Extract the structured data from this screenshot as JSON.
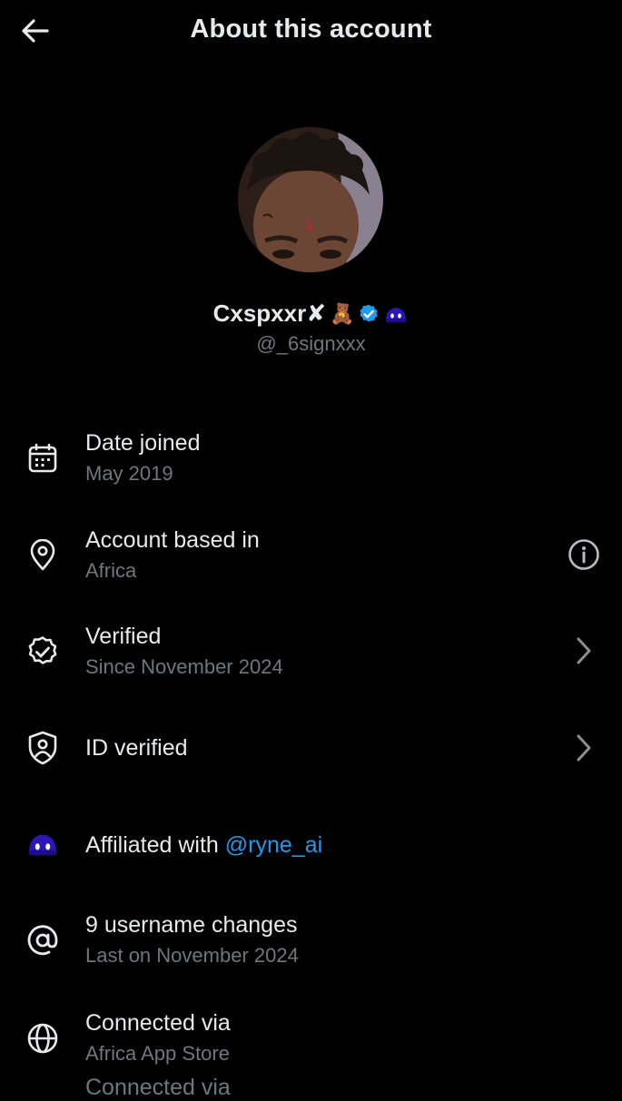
{
  "header": {
    "title": "About this account",
    "back_icon": "arrow-left-icon"
  },
  "profile": {
    "display_name": "Cxspxxr✘",
    "emoji_badge": "🧸",
    "verified_badge_icon": "verified-checkmark-icon",
    "affiliate_badge_icon": "ryne-ai-affiliate-icon",
    "handle": "@_6signxxx"
  },
  "rows": {
    "date_joined": {
      "icon": "calendar-icon",
      "title": "Date joined",
      "subtitle": "May 2019"
    },
    "based_in": {
      "icon": "location-pin-icon",
      "title": "Account based in",
      "subtitle": "Africa",
      "action_icon": "info-icon"
    },
    "verified": {
      "icon": "verified-outline-icon",
      "title": "Verified",
      "subtitle": "Since November 2024",
      "action_icon": "chevron-right-icon"
    },
    "id_verified": {
      "icon": "shield-user-icon",
      "title": "ID verified",
      "action_icon": "chevron-right-icon"
    },
    "affiliated": {
      "icon": "ryne-ai-affiliate-icon",
      "prefix": "Affiliated with",
      "mention": "@ryne_ai"
    },
    "username_changes": {
      "icon": "at-sign-icon",
      "title": "9 username changes",
      "subtitle": "Last on November 2024"
    },
    "connected_via": {
      "icon": "globe-icon",
      "title": "Connected via",
      "subtitle": "Africa App Store"
    }
  },
  "cutoff_text": "Connected via",
  "colors": {
    "background": "#000000",
    "primary_text": "#e7e9ea",
    "secondary_text": "#71767b",
    "accent": "#1d9bf0",
    "affiliate_purple": "#3b1fd1"
  }
}
